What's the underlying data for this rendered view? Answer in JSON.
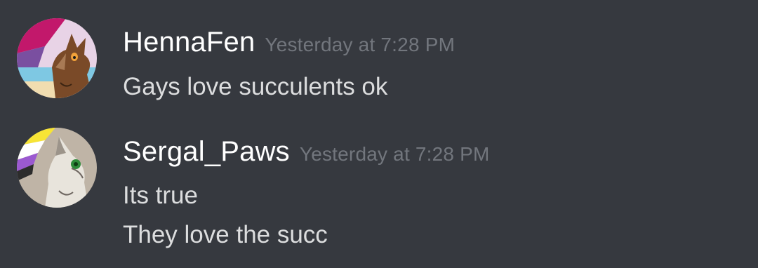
{
  "colors": {
    "background": "#36393f",
    "username": "#ffffff",
    "timestamp": "#72767d",
    "message_text": "#dcddde"
  },
  "messages": [
    {
      "username": "HennaFen",
      "timestamp": "Yesterday at 7:28 PM",
      "avatar": "fox-avatar-bi-flag",
      "lines": [
        "Gays love succulents ok"
      ]
    },
    {
      "username": "Sergal_Paws",
      "timestamp": "Yesterday at 7:28 PM",
      "avatar": "sergal-avatar-nonbinary-flag",
      "lines": [
        "Its true",
        "They love the succ"
      ]
    }
  ]
}
